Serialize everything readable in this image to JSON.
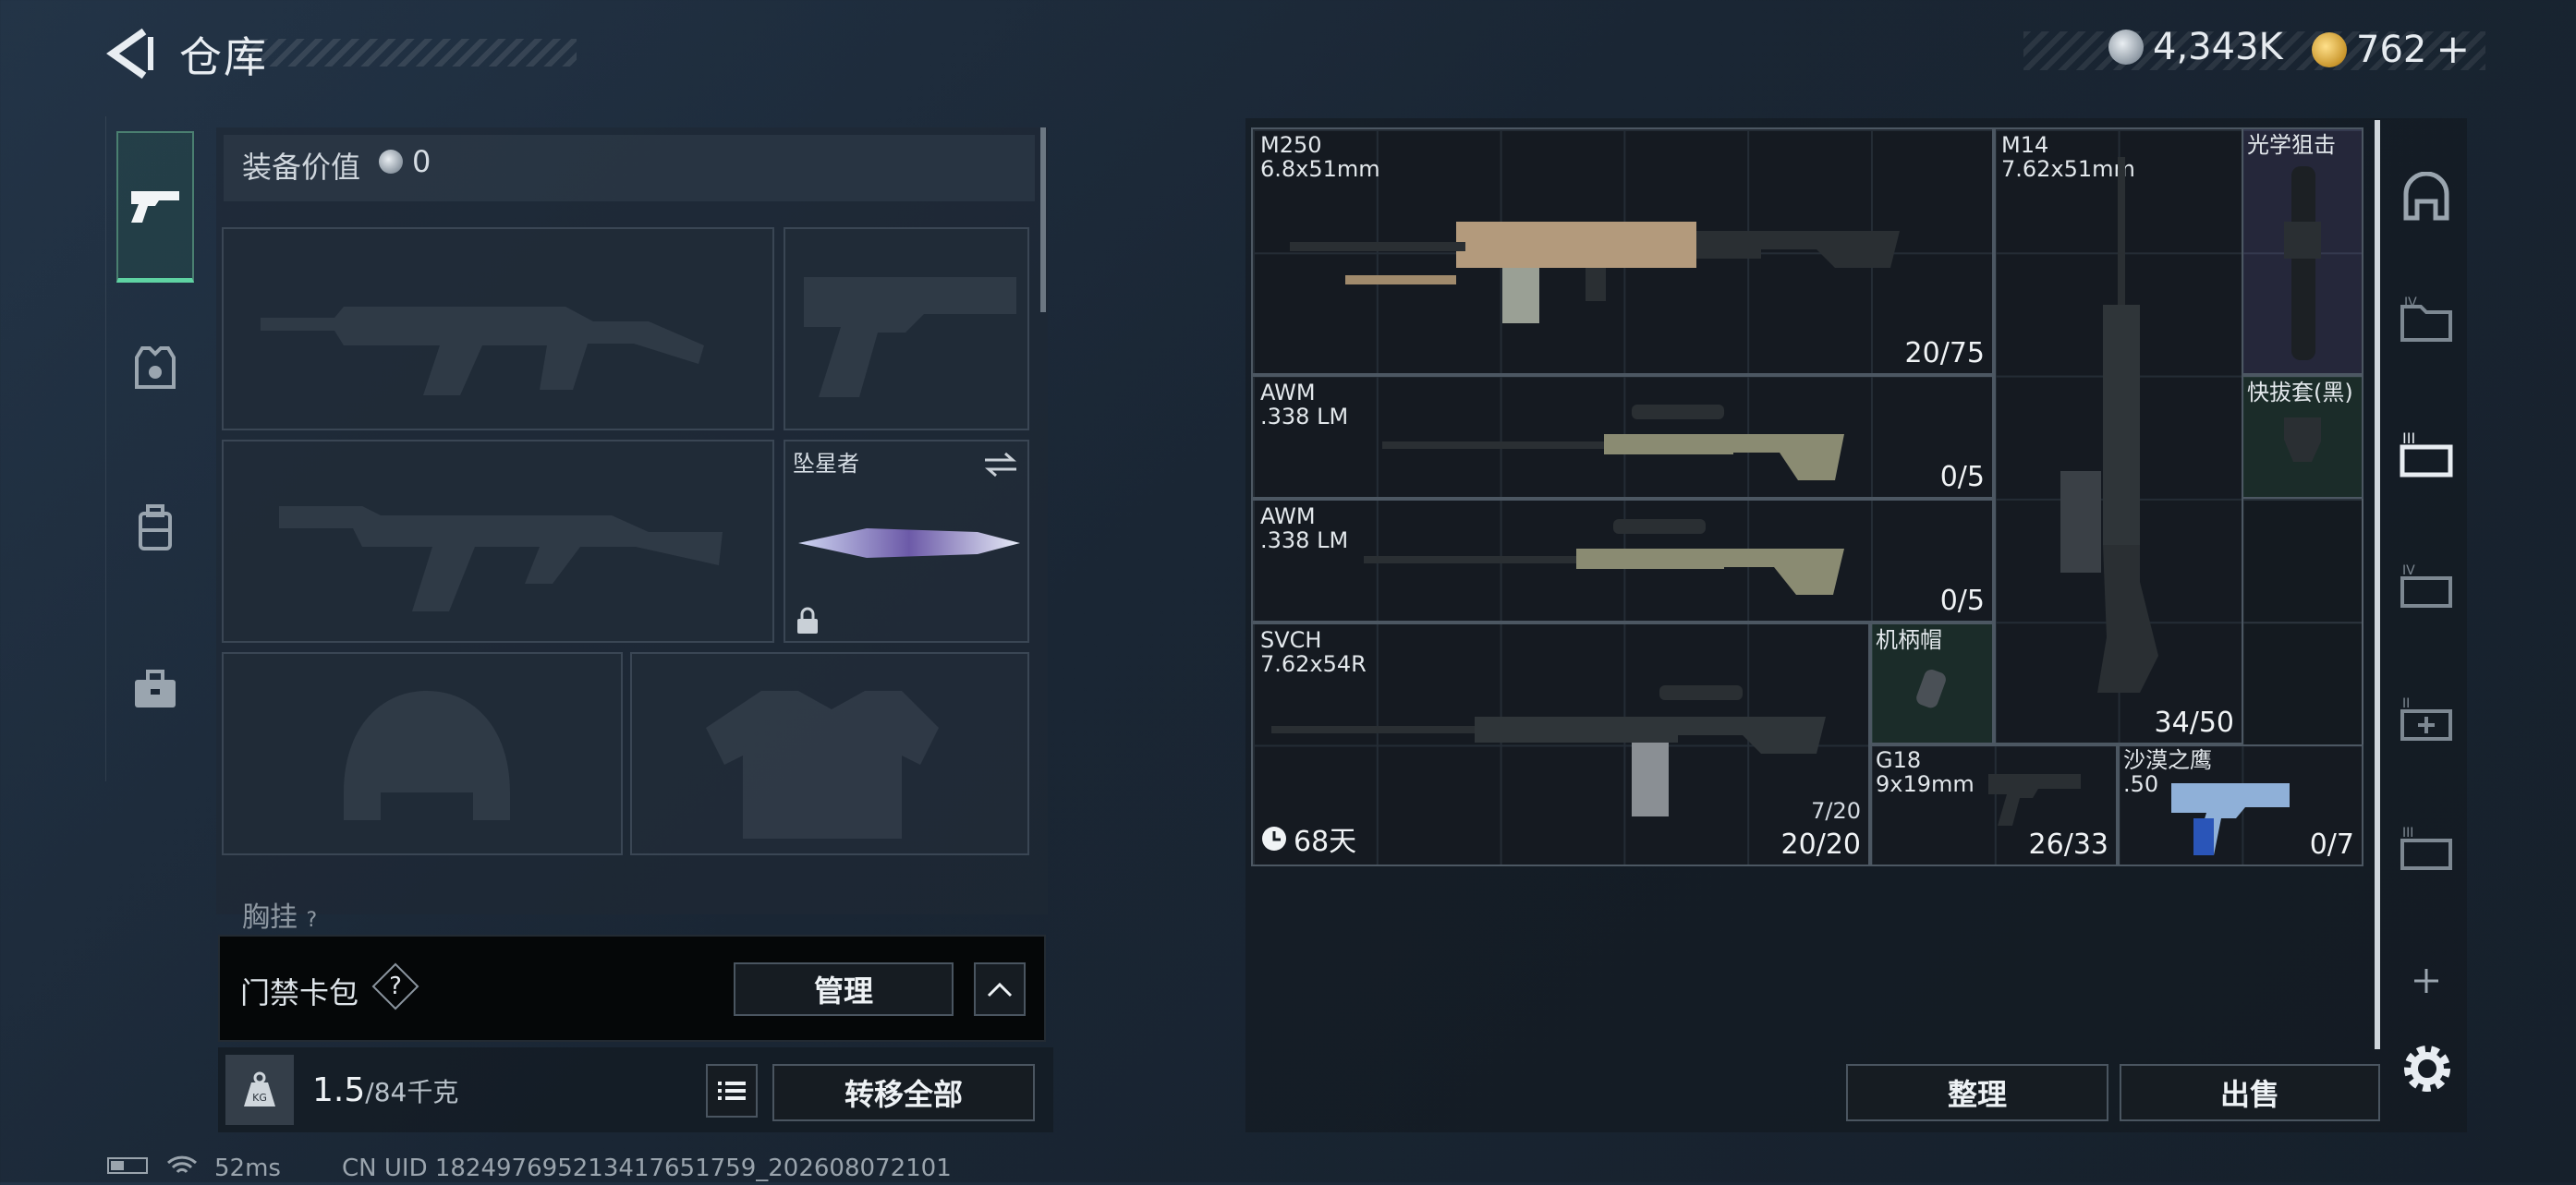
{
  "header": {
    "title": "仓库"
  },
  "currency": {
    "silver": "4,343K",
    "gold": "762",
    "plus": "+"
  },
  "equipment": {
    "value_label": "装备价值",
    "value": "0",
    "melee_name": "坠星者",
    "chest_label": "胸挂",
    "chest_badge": "?"
  },
  "card_bag": {
    "label": "门禁卡包",
    "help": "?",
    "manage_label": "管理"
  },
  "weight": {
    "value": "1.5",
    "max": "/84千克",
    "transfer_label": "转移全部"
  },
  "stash": {
    "items": [
      {
        "name": "M250\n6.8x51mm",
        "count": "20/75"
      },
      {
        "name": "M14\n7.62x51mm",
        "count": "34/50"
      },
      {
        "name": "光学狙击",
        "count": ""
      },
      {
        "name": "快拔套(黑)",
        "count": ""
      },
      {
        "name": "AWM\n.338 LM",
        "count": "0/5"
      },
      {
        "name": "AWM\n.338 LM",
        "count": "0/5"
      },
      {
        "name": "SVCH\n7.62x54R",
        "count": "20/20",
        "sub": "7/20",
        "timer": "68天"
      },
      {
        "name": "机柄帽",
        "count": ""
      },
      {
        "name": "G18\n9x19mm",
        "count": "26/33"
      },
      {
        "name": "沙漠之鹰\n.50",
        "count": "0/7"
      }
    ],
    "sort_label": "整理",
    "sell_label": "出售"
  },
  "status_bar": {
    "ping": "52ms",
    "uid": "CN UID 1824976952134176517​59_202608072101"
  },
  "colors": {
    "accent": "#5fd3a3",
    "grid_line": "#2c353e"
  }
}
